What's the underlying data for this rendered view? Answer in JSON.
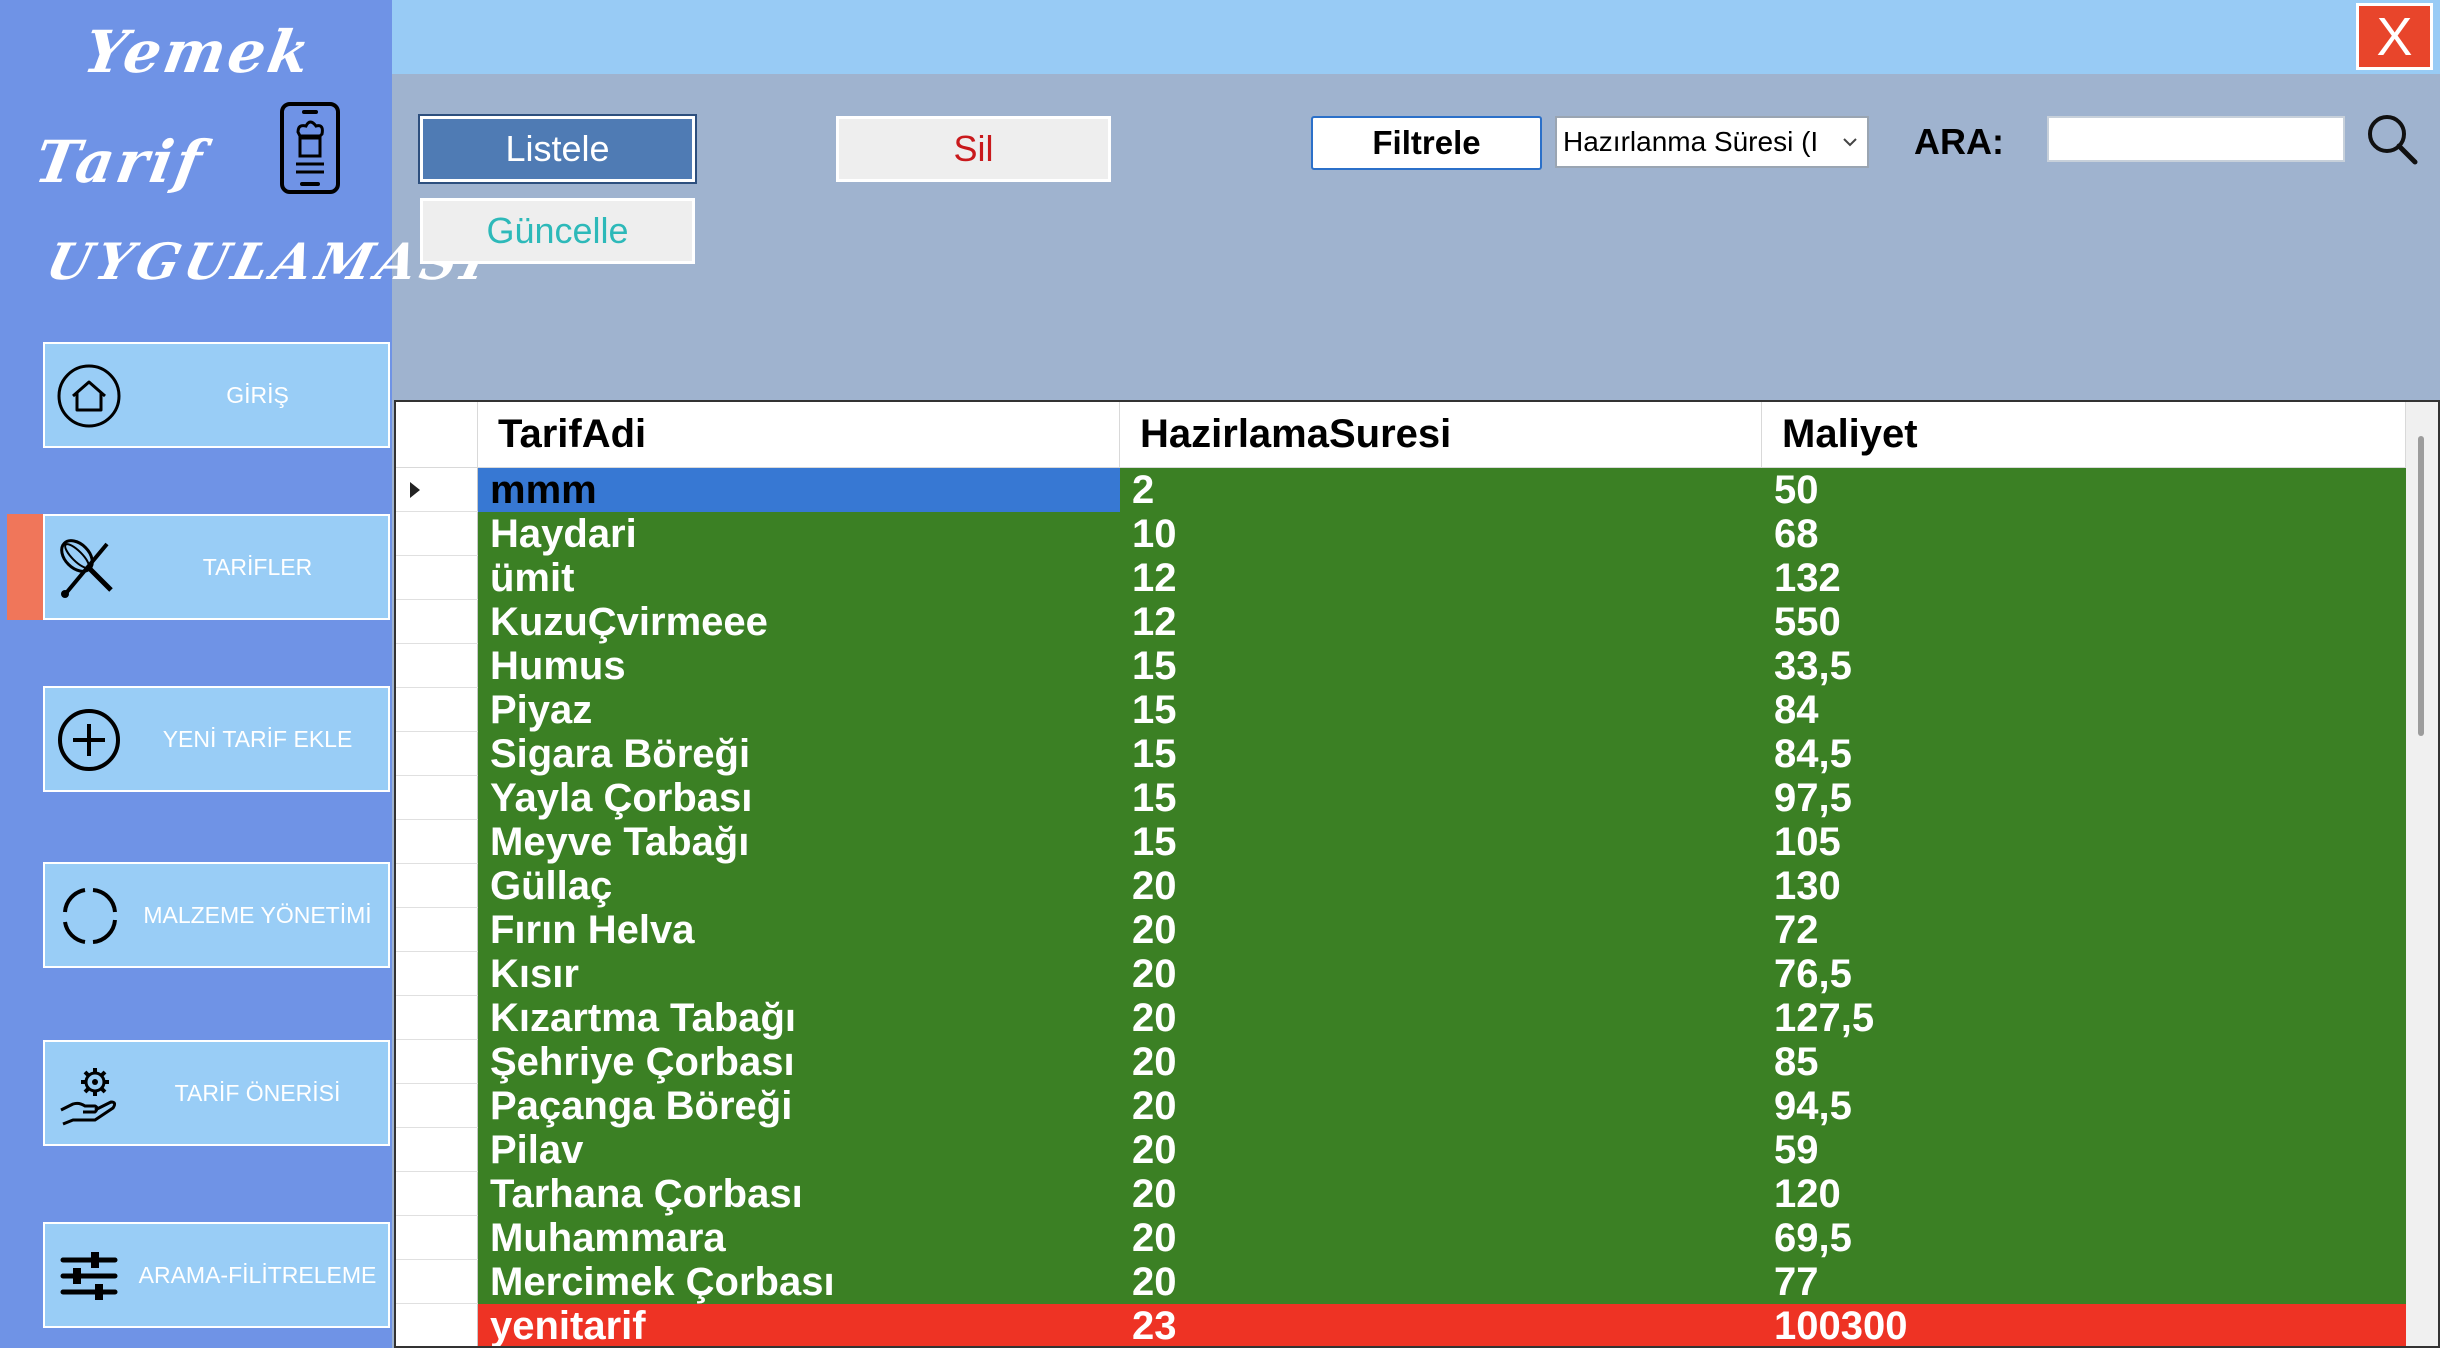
{
  "logo": {
    "line1": "Yemek",
    "line2": "Tarif",
    "line3": "UYGULAMASI"
  },
  "sidebar": {
    "items": [
      {
        "label": "GİRİŞ",
        "icon": "home-icon"
      },
      {
        "label": "TARİFLER",
        "icon": "whisk-icon",
        "active": true
      },
      {
        "label": "YENİ TARİF EKLE",
        "icon": "plus-circle-icon"
      },
      {
        "label": "MALZEME YÖNETİMİ",
        "icon": "loading-circle-icon"
      },
      {
        "label": "TARİF ÖNERİSİ",
        "icon": "hand-gear-icon"
      },
      {
        "label": "ARAMA-FİLİTRELEME",
        "icon": "sliders-icon"
      }
    ]
  },
  "window": {
    "close_label": "X"
  },
  "toolbar": {
    "listele": "Listele",
    "guncelle": "Güncelle",
    "sil": "Sil",
    "filtrele": "Filtrele",
    "filter_select_value": "Hazırlanma Süresi (I",
    "search_label": "ARA:",
    "search_value": ""
  },
  "colors": {
    "sidebar_bg": "#6f93e6",
    "nav_btn_bg": "#99cdf6",
    "active_marker": "#f0765a",
    "row_green": "#3b8024",
    "row_red": "#ee3324",
    "selected_cell": "#3778d3",
    "close_btn": "#e8452b"
  },
  "grid": {
    "columns": [
      "TarifAdi",
      "HazirlamaSuresi",
      "Maliyet"
    ],
    "rows": [
      {
        "cells": [
          "mmm",
          "2",
          "50"
        ],
        "status": "green",
        "selected": true
      },
      {
        "cells": [
          "Haydari",
          "10",
          "68"
        ],
        "status": "green"
      },
      {
        "cells": [
          "ümit",
          "12",
          "132"
        ],
        "status": "green"
      },
      {
        "cells": [
          "KuzuÇvirmeee",
          "12",
          "550"
        ],
        "status": "green"
      },
      {
        "cells": [
          "Humus",
          "15",
          "33,5"
        ],
        "status": "green"
      },
      {
        "cells": [
          "Piyaz",
          "15",
          "84"
        ],
        "status": "green"
      },
      {
        "cells": [
          "Sigara Böreği",
          "15",
          "84,5"
        ],
        "status": "green"
      },
      {
        "cells": [
          "Yayla Çorbası",
          "15",
          "97,5"
        ],
        "status": "green"
      },
      {
        "cells": [
          "Meyve Tabağı",
          "15",
          "105"
        ],
        "status": "green"
      },
      {
        "cells": [
          "Güllaç",
          "20",
          "130"
        ],
        "status": "green"
      },
      {
        "cells": [
          "Fırın Helva",
          "20",
          "72"
        ],
        "status": "green"
      },
      {
        "cells": [
          "Kısır",
          "20",
          "76,5"
        ],
        "status": "green"
      },
      {
        "cells": [
          "Kızartma Tabağı",
          "20",
          "127,5"
        ],
        "status": "green"
      },
      {
        "cells": [
          "Şehriye Çorbası",
          "20",
          "85"
        ],
        "status": "green"
      },
      {
        "cells": [
          "Paçanga Böreği",
          "20",
          "94,5"
        ],
        "status": "green"
      },
      {
        "cells": [
          "Pilav",
          "20",
          "59"
        ],
        "status": "green"
      },
      {
        "cells": [
          "Tarhana Çorbası",
          "20",
          "120"
        ],
        "status": "green"
      },
      {
        "cells": [
          "Muhammara",
          "20",
          "69,5"
        ],
        "status": "green"
      },
      {
        "cells": [
          "Mercimek Çorbası",
          "20",
          "77"
        ],
        "status": "green"
      },
      {
        "cells": [
          "yenitarif",
          "23",
          "100300"
        ],
        "status": "red"
      }
    ]
  }
}
